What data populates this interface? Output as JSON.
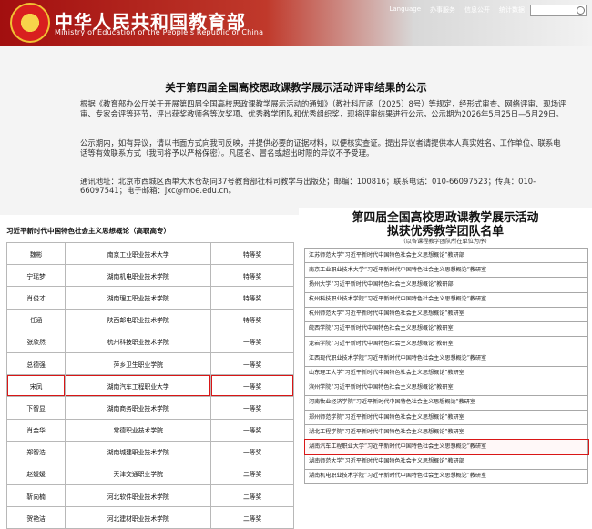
{
  "header": {
    "site_title": "中华人民共和国教育部",
    "site_subtitle": "Ministry of Education of the People's Republic of China",
    "top_links": [
      "Language",
      "办事服务",
      "信息公开",
      "统计数据"
    ],
    "search_placeholder": ""
  },
  "notice": {
    "title": "关于第四届全国高校思政课教学展示活动评审结果的公示",
    "paragraph1": "根据《教育部办公厅关于开展第四届全国高校思政课教学展示活动的通知》（教社科厅函〔2025〕8号）等规定，经形式审查、网络评审、现场评审、专家会评等环节，评出获奖教师各等次奖项、优秀教学团队和优秀组织奖，现将评审结果进行公示，公示期为2026年5月25日—5月29日。",
    "paragraph2": "公示期内，如有异议，请以书面方式向我司反映，并提供必要的证据材料，以便核实查证。提出异议者请提供本人真实姓名、工作单位、联系电话等有效联系方式（我司将予以严格保密）。凡匿名、冒名或超出时限的异议不予受理。",
    "address_line": "通讯地址：北京市西城区西单大木仓胡同37号教育部社科司教学与出版处；邮编：100816；联系电话：010-66097523；传真：010-66097541；电子邮箱：jxc@moe.edu.cn。"
  },
  "left_panel": {
    "title": "习近平新时代中国特色社会主义思想概论（高职高专）",
    "rows": [
      [
        "魏彬",
        "南京工业职业技术大学",
        "特等奖"
      ],
      [
        "宁瑶梦",
        "湖南机电职业技术学院",
        "特等奖"
      ],
      [
        "肖俊才",
        "湖南理工职业技术学院",
        "特等奖"
      ],
      [
        "任涵",
        "陕西邮电职业技术学院",
        "特等奖"
      ],
      [
        "张欣然",
        "杭州科技职业技术学院",
        "一等奖"
      ],
      [
        "总德强",
        "萍乡卫生职业学院",
        "一等奖"
      ],
      [
        "宋凤",
        "湖南汽车工程职业大学",
        "一等奖"
      ],
      [
        "下智显",
        "湖南商务职业技术学院",
        "一等奖"
      ],
      [
        "肖金华",
        "常德职业技术学院",
        "一等奖"
      ],
      [
        "郑智浩",
        "湖南城建职业技术学院",
        "一等奖"
      ],
      [
        "赵媛媛",
        "天津交通职业学院",
        "二等奖"
      ],
      [
        "靳向楠",
        "河北软件职业技术学院",
        "二等奖"
      ],
      [
        "贺艳洁",
        "河北建材职业技术学院",
        "二等奖"
      ]
    ]
  },
  "right_panel": {
    "title_line1": "第四届全国高校思政课教学展示活动",
    "title_line2": "拟获优秀教学团队名单",
    "note": "（以各课程教学团队所在单位为序）",
    "rows": [
      "江苏师范大学“习近平新时代中国特色社会主义思想概论”教研部",
      "南京工业职业技术大学“习近平新时代中国特色社会主义思想概论”教研室",
      "扬州大学“习近平新时代中国特色社会主义思想概论”教研部",
      "杭州科技职业技术学院“习近平新时代中国特色社会主义思想概论”教研室",
      "杭州师范大学“习近平新时代中国特色社会主义思想概论”教研室",
      "皖西学院“习近平新时代中国特色社会主义思想概论”教研室",
      "龙岩学院“习近平新时代中国特色社会主义思想概论”教研室",
      "江西现代职业技术学院“习近平新时代中国特色社会主义思想概论”教研室",
      "山东理工大学“习近平新时代中国特色社会主义思想概论”教研室",
      "滨州学院“习近平新时代中国特色社会主义思想概论”教研室",
      "河南牧业经济学院“习近平新时代中国特色社会主义思想概论”教研室",
      "郑州师范学院“习近平新时代中国特色社会主义思想概论”教研室",
      "湖北工程学院“习近平新时代中国特色社会主义思想概论”教研室",
      "湖南汽车工程职业大学“习近平新时代中国特色社会主义思想概论”教研室",
      "湖南师范大学“习近平新时代中国特色社会主义思想概论”教研部",
      "湖南机电职业技术学院“习近平新时代中国特色社会主义思想概论”教研室"
    ]
  }
}
